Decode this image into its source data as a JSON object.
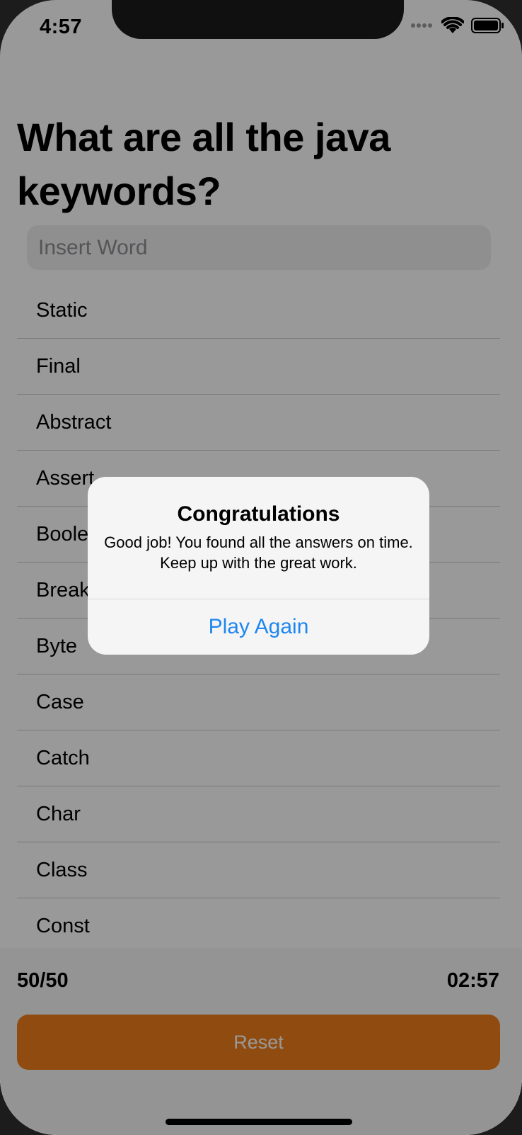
{
  "status_bar": {
    "time": "4:57"
  },
  "question": {
    "title": "What are all the java keywords?"
  },
  "search": {
    "placeholder": "Insert Word",
    "value": ""
  },
  "keywords": [
    "Static",
    "Final",
    "Abstract",
    "Assert",
    "Boolean",
    "Break",
    "Byte",
    "Case",
    "Catch",
    "Char",
    "Class",
    "Const"
  ],
  "footer": {
    "score": "50/50",
    "timer": "02:57",
    "reset_label": "Reset"
  },
  "alert": {
    "title": "Congratulations",
    "message": "Good job! You found all the answers on time. Keep up with the great work.",
    "button_label": "Play Again"
  },
  "colors": {
    "accent_orange": "#f07f1b",
    "link_blue": "#1e86f0",
    "dim_overlay": "rgba(0,0,0,0.4)"
  },
  "icons": [
    "cellular-signal-icon",
    "wifi-icon",
    "battery-icon"
  ]
}
